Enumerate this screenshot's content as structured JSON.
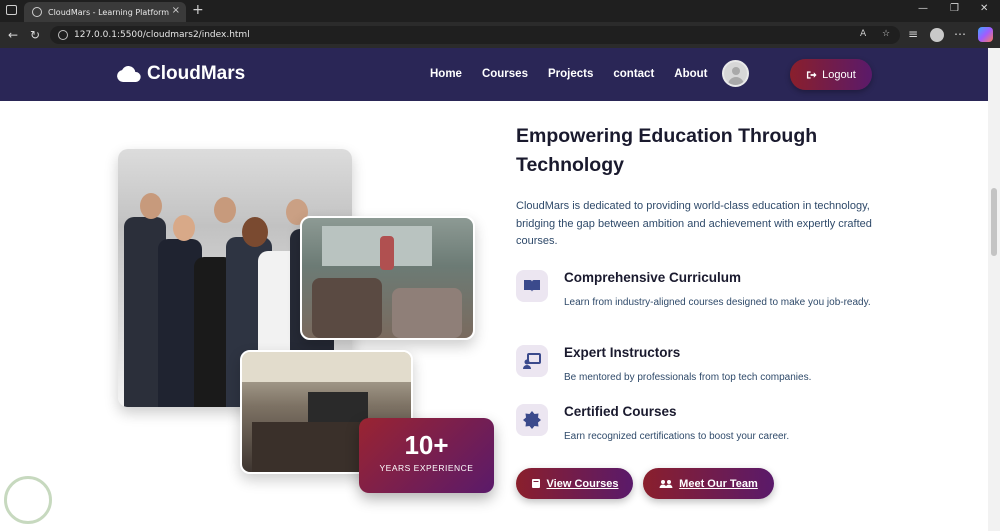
{
  "browser": {
    "tab_title": "CloudMars - Learning Platform",
    "tab_close": "×",
    "new_tab": "+",
    "url": "127.0.0.1:5500/cloudmars2/index.html",
    "window_controls": [
      "—",
      "❐",
      "✕"
    ]
  },
  "site": {
    "logo_text": "CloudMars",
    "nav": [
      "Home",
      "Courses",
      "Projects",
      "contact",
      "About"
    ],
    "logout_label": "Logout"
  },
  "hero": {
    "heading": "Empowering Education Through Technology",
    "intro": "CloudMars is dedicated to providing world-class education in technology, bridging the gap between ambition and achievement with expertly crafted courses.",
    "badge_number": "10+",
    "badge_label": "YEARS EXPERIENCE",
    "features": [
      {
        "title": "Comprehensive Curriculum",
        "desc": "Learn from industry-aligned courses designed to make you job-ready.",
        "icon": "book-icon"
      },
      {
        "title": "Expert Instructors",
        "desc": "Be mentored by professionals from top tech companies.",
        "icon": "chalkboard-teacher-icon"
      },
      {
        "title": "Certified Courses",
        "desc": "Earn recognized certifications to boost your career.",
        "icon": "certificate-icon"
      }
    ],
    "buttons": {
      "view_courses": "View Courses",
      "meet_team": "Meet Our Team"
    }
  },
  "colors": {
    "nav_bg": "#2a2656",
    "accent_start": "#8a1f2c",
    "accent_end": "#5a1a6a",
    "heading": "#1a1a2e",
    "body_text": "#2f4a6a",
    "icon_bg": "#ece6f1",
    "icon_color": "#3b4a8c"
  }
}
